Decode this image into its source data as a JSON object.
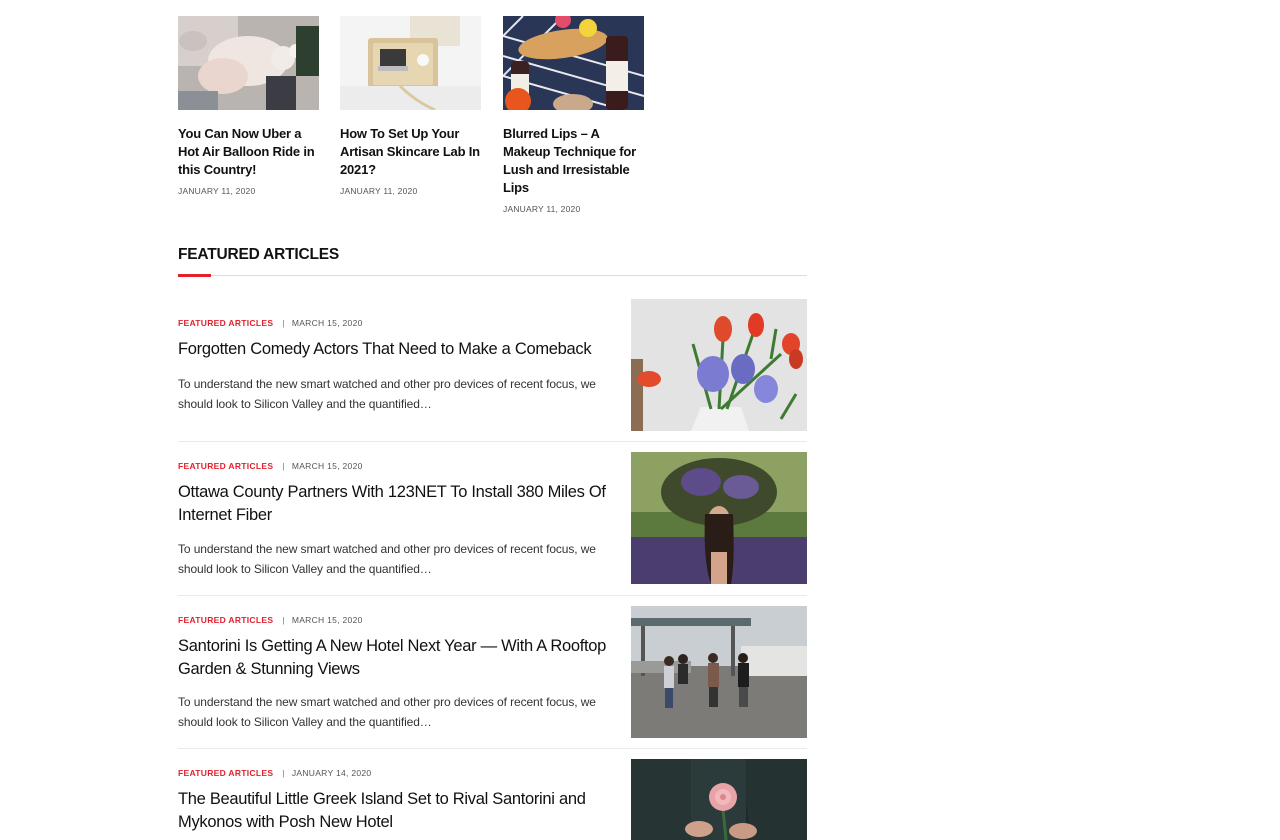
{
  "top_cards": [
    {
      "title": "You Can Now Uber a Hot Air Balloon Ride in this Country!",
      "date": "JANUARY 11, 2020"
    },
    {
      "title": "How To Set Up Your Artisan Skincare Lab In 2021?",
      "date": "JANUARY 11, 2020"
    },
    {
      "title": "Blurred Lips – A Makeup Technique for Lush and Irresistable Lips",
      "date": "JANUARY 11, 2020"
    }
  ],
  "section": {
    "title": "FEATURED ARTICLES"
  },
  "articles": [
    {
      "category": "FEATURED ARTICLES",
      "separator": "|",
      "date": "MARCH 15, 2020",
      "title": "Forgotten Comedy Actors That Need to Make a Comeback",
      "excerpt": "To understand the new smart watched and other pro devices of recent focus, we should look to Silicon Valley and the quantified…"
    },
    {
      "category": "FEATURED ARTICLES",
      "separator": "|",
      "date": "MARCH 15, 2020",
      "title": "Ottawa County Partners With 123NET To Install 380 Miles Of Internet Fiber",
      "excerpt": "To understand the new smart watched and other pro devices of recent focus, we should look to Silicon Valley and the quantified…"
    },
    {
      "category": "FEATURED ARTICLES",
      "separator": "|",
      "date": "MARCH 15, 2020",
      "title": "Santorini Is Getting A New Hotel Next Year — With A Rooftop Garden & Stunning Views",
      "excerpt": "To understand the new smart watched and other pro devices of recent focus, we should look to Silicon Valley and the quantified…"
    },
    {
      "category": "FEATURED ARTICLES",
      "separator": "|",
      "date": "JANUARY 14, 2020",
      "title": "The Beautiful Little Greek Island Set to Rival Santorini and Mykonos with Posh New Hotel"
    }
  ],
  "colors": {
    "accent": "#e3212d",
    "text": "#111111",
    "muted": "#555555",
    "divider": "#e9e9e9"
  }
}
